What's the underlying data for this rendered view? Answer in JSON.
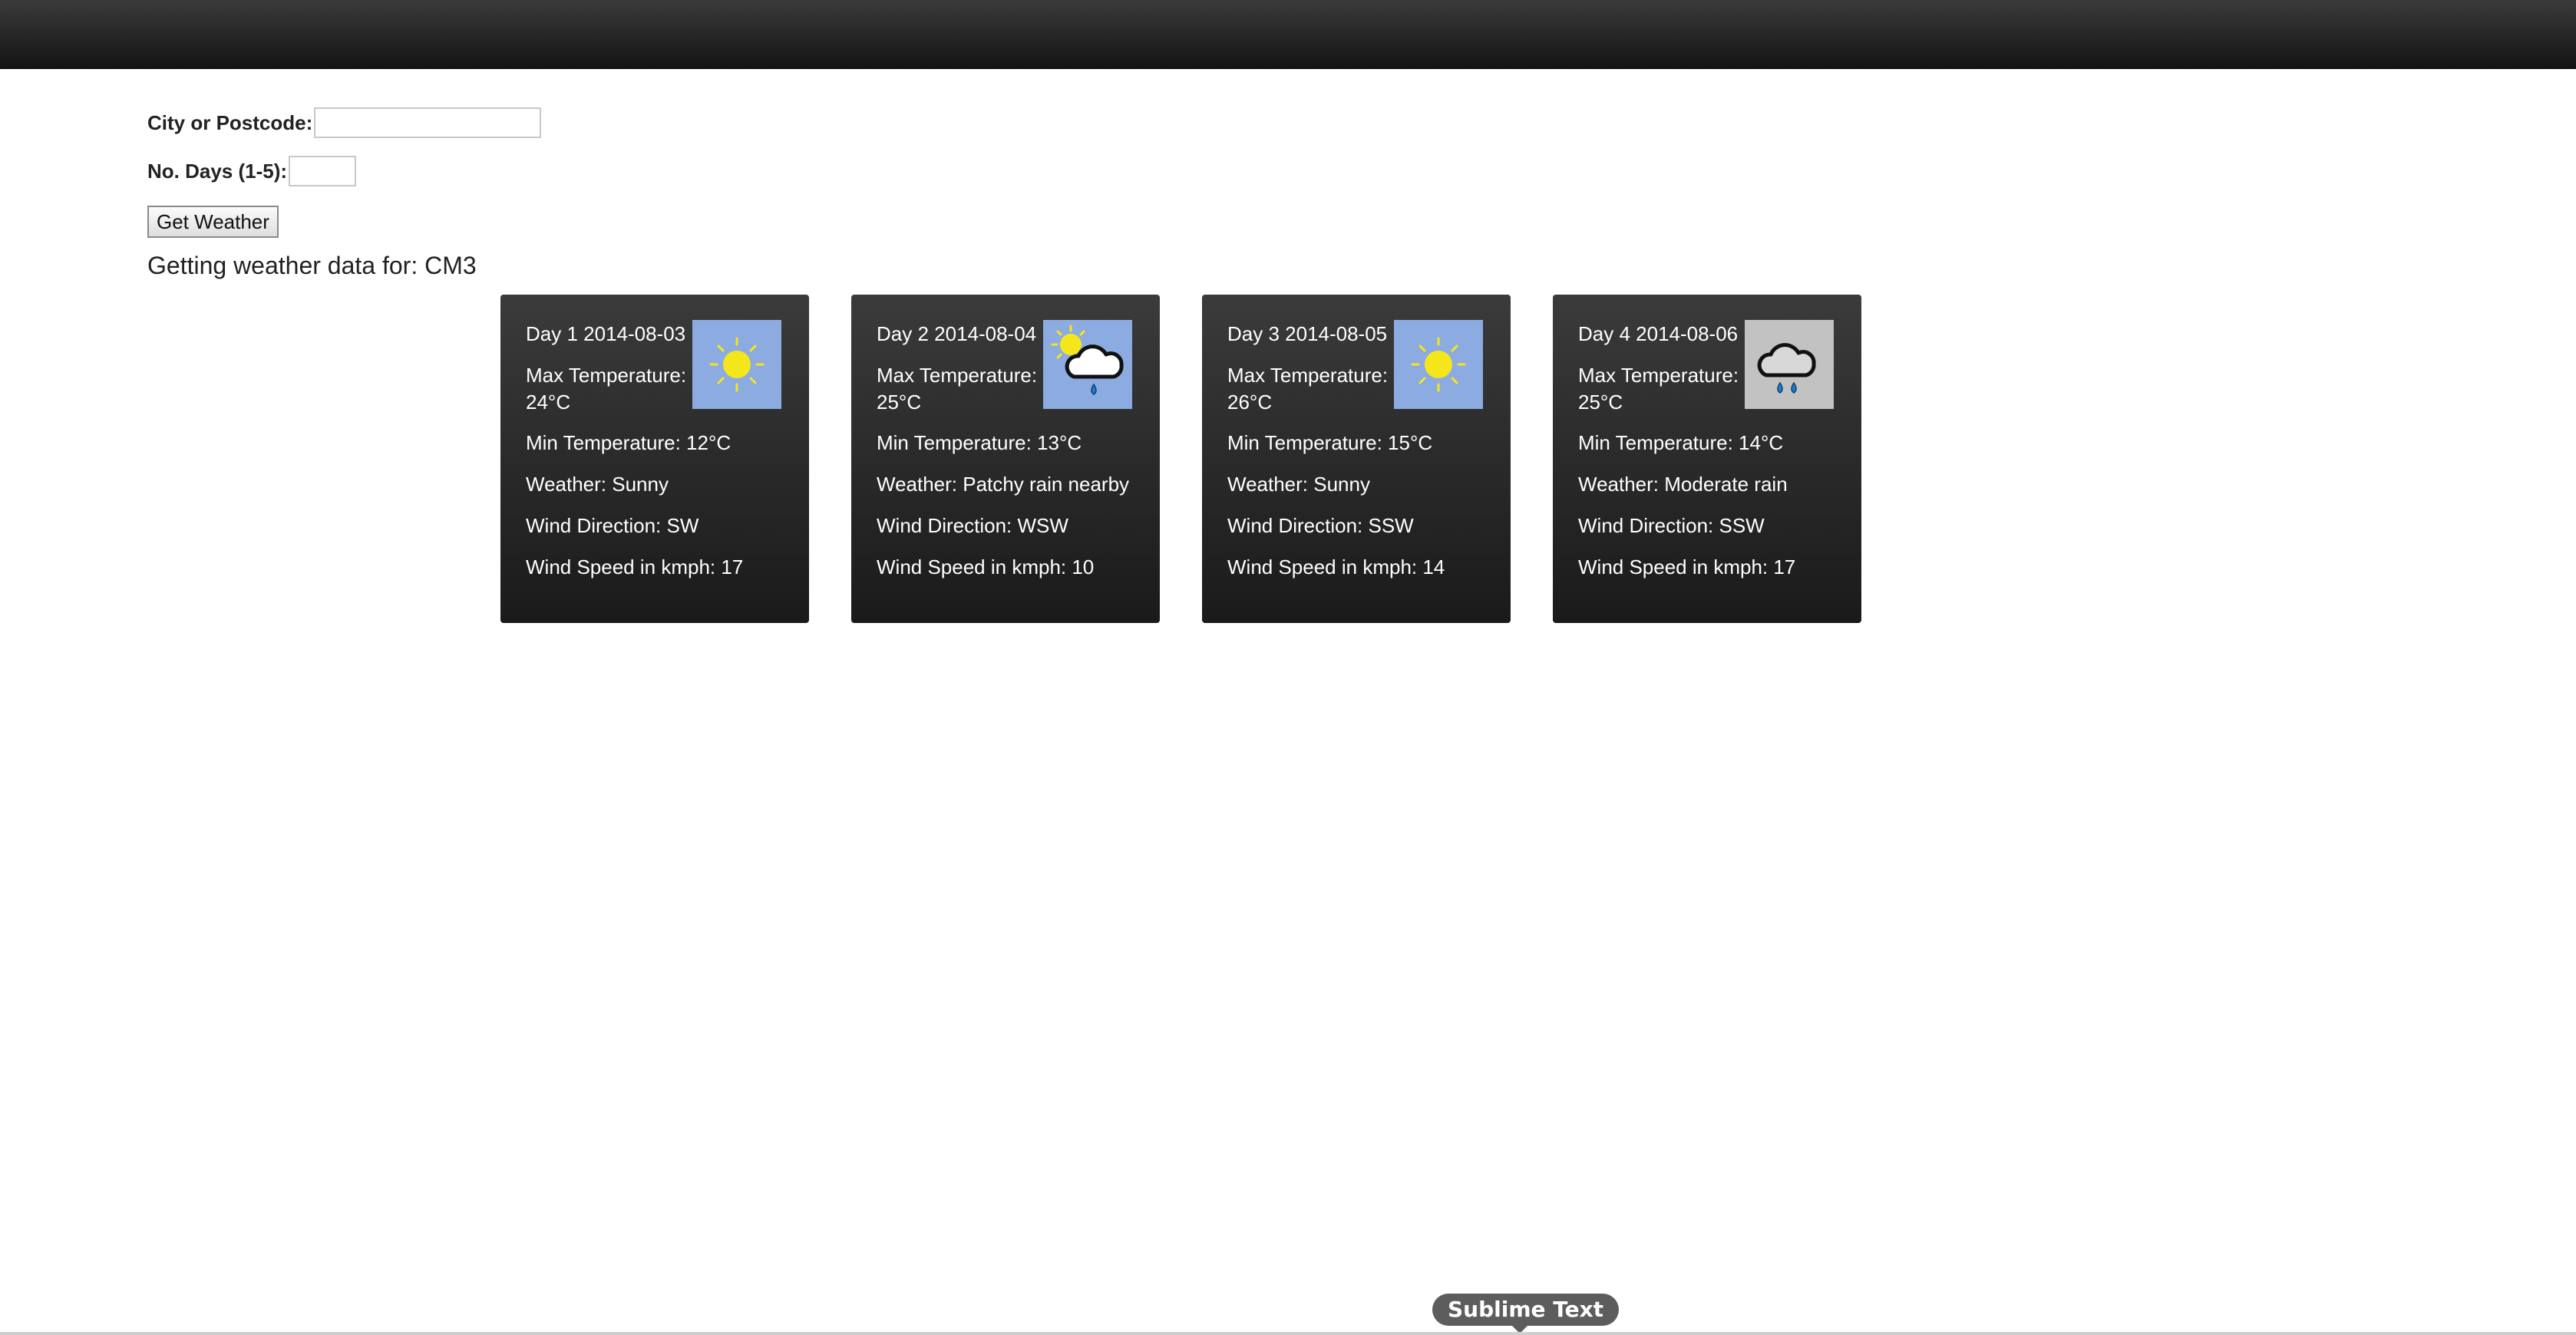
{
  "form": {
    "city_label": "City or Postcode:",
    "city_value": "",
    "days_label": "No. Days (1-5):",
    "days_value": "",
    "submit_label": "Get Weather"
  },
  "status": "Getting weather data for: CM3",
  "days": [
    {
      "title": "Day 1 2014-08-03",
      "max_label": "Max Temperature:",
      "max_value": "24°C",
      "min": "Min Temperature: 12°C",
      "weather": "Weather: Sunny",
      "wind_dir": "Wind Direction: SW",
      "wind_speed": "Wind Speed in kmph: 17",
      "icon": "sunny-icon"
    },
    {
      "title": "Day 2 2014-08-04",
      "max_label": "Max Temperature:",
      "max_value": "25°C",
      "min": "Min Temperature: 13°C",
      "weather": "Weather: Patchy rain nearby",
      "wind_dir": "Wind Direction: WSW",
      "wind_speed": "Wind Speed in kmph: 10",
      "icon": "patchy-rain-icon"
    },
    {
      "title": "Day 3 2014-08-05",
      "max_label": "Max Temperature:",
      "max_value": "26°C",
      "min": "Min Temperature: 15°C",
      "weather": "Weather: Sunny",
      "wind_dir": "Wind Direction: SSW",
      "wind_speed": "Wind Speed in kmph: 14",
      "icon": "sunny-icon"
    },
    {
      "title": "Day 4 2014-08-06",
      "max_label": "Max Temperature:",
      "max_value": "25°C",
      "min": "Min Temperature: 14°C",
      "weather": "Weather: Moderate rain",
      "wind_dir": "Wind Direction: SSW",
      "wind_speed": "Wind Speed in kmph: 17",
      "icon": "moderate-rain-icon"
    }
  ],
  "dock": {
    "tooltip": "Sublime Text"
  },
  "colors": {
    "sky_blue": "#8cabe0",
    "overcast_grey": "#c2c2c2",
    "sun_yellow": "#f5e61c",
    "rain_blue": "#1f7ed6"
  }
}
